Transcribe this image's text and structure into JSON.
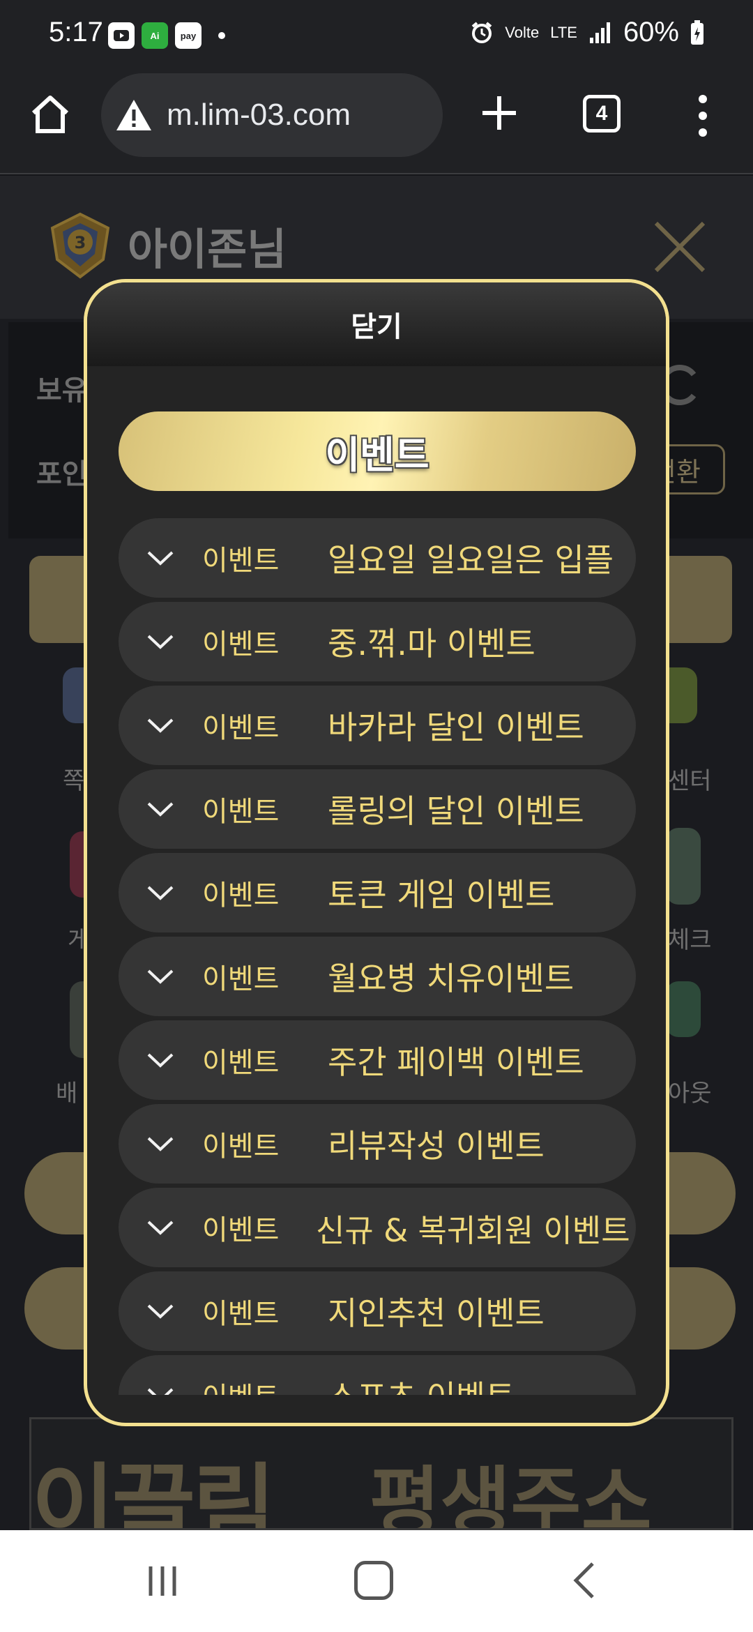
{
  "status_bar": {
    "time": "5:17",
    "notif_icons": [
      "youtube-icon",
      "messaging-icon",
      "pay-icon"
    ],
    "pay_label": "pay",
    "green_label": "Ai",
    "volte": "Volte",
    "lte": "LTE",
    "battery": "60%"
  },
  "browser": {
    "url": "m.lim-03.com",
    "tab_count": "4"
  },
  "background_page": {
    "username": "아이존님",
    "label_hold": "보유",
    "label_point": "포인",
    "convert_button": "전환",
    "side_labels": {
      "left_1": "쪽",
      "left_2": "게",
      "left_3": "배",
      "right_1": "센터",
      "right_2": "체크",
      "right_3": "아웃"
    },
    "banner_left": "이끌림",
    "banner_right": "평생주소"
  },
  "modal": {
    "close_label": "닫기",
    "title": "이벤트",
    "events": [
      {
        "category": "이벤트",
        "name": "일요일 일요일은 입플"
      },
      {
        "category": "이벤트",
        "name": "중.꺾.마 이벤트"
      },
      {
        "category": "이벤트",
        "name": "바카라 달인 이벤트"
      },
      {
        "category": "이벤트",
        "name": "롤링의 달인 이벤트"
      },
      {
        "category": "이벤트",
        "name": "토큰 게임 이벤트"
      },
      {
        "category": "이벤트",
        "name": "월요병 치유이벤트"
      },
      {
        "category": "이벤트",
        "name": "주간 페이백 이벤트"
      },
      {
        "category": "이벤트",
        "name": "리뷰작성 이벤트"
      },
      {
        "category": "이벤트",
        "name": "신규 & 복귀회원 이벤트"
      },
      {
        "category": "이벤트",
        "name": "지인추천 이벤트"
      },
      {
        "category": "이벤트",
        "name": "스포츠 이벤트"
      }
    ]
  },
  "colors": {
    "gold": "#f0d97a",
    "modal_border": "#f3e08f",
    "item_bg": "#353535"
  }
}
